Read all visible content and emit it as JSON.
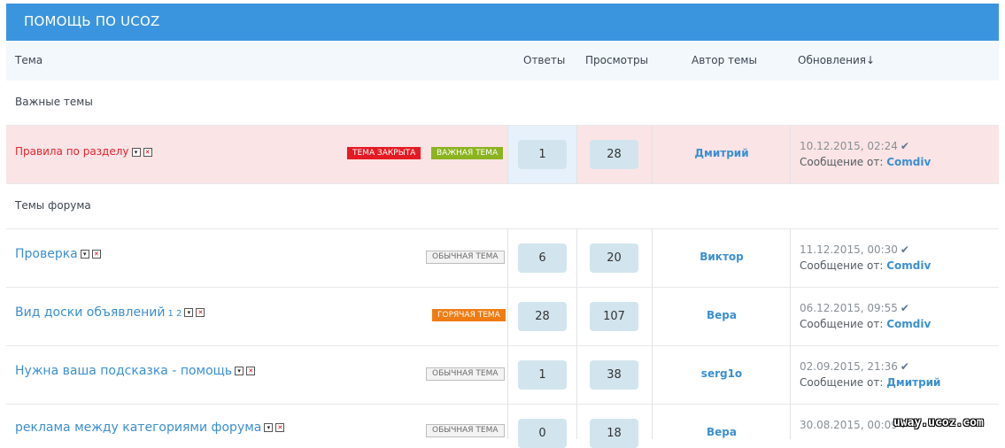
{
  "forum": {
    "title": "ПОМОЩЬ ПО UCOZ"
  },
  "columns": {
    "topic": "Тема",
    "replies": "Ответы",
    "views": "Просмотры",
    "author": "Автор темы",
    "updates": "Обновления↓"
  },
  "sections": {
    "important": "Важные темы",
    "forum": "Темы форума"
  },
  "message_prefix": "Сообщение от:",
  "topics": [
    {
      "title": "Правила по разделу",
      "badges": [
        "ТЕМА ЗАКРЫТА",
        "ВАЖНАЯ ТЕМА"
      ],
      "replies": "1",
      "views": "28",
      "author": "Дмитрий",
      "date": "10.12.2015, 02:24",
      "last_by": "Comdiv"
    },
    {
      "title": "Проверка",
      "badge": "ОБЫЧНАЯ ТЕМА",
      "replies": "6",
      "views": "20",
      "author": "Виктор",
      "date": "11.12.2015, 00:30",
      "last_by": "Comdiv"
    },
    {
      "title": "Вид доски объявлений",
      "pages": "1 2",
      "badge": "ГОРЯЧАЯ ТЕМА",
      "replies": "28",
      "views": "107",
      "author": "Вера",
      "date": "06.12.2015, 09:55",
      "last_by": "Comdiv"
    },
    {
      "title": "Нужна ваша подсказка - помощь",
      "badge": "ОБЫЧНАЯ ТЕМА",
      "replies": "1",
      "views": "38",
      "author": "serg1o",
      "date": "02.09.2015, 21:36",
      "last_by": "Дмитрий"
    },
    {
      "title": "реклама между категориями форума",
      "badge": "ОБЫЧНАЯ ТЕМА",
      "replies": "0",
      "views": "18",
      "author": "Вера",
      "date": "30.08.2015, 00:09",
      "last_by": ""
    }
  ],
  "watermark": "uway.ucoz.com"
}
